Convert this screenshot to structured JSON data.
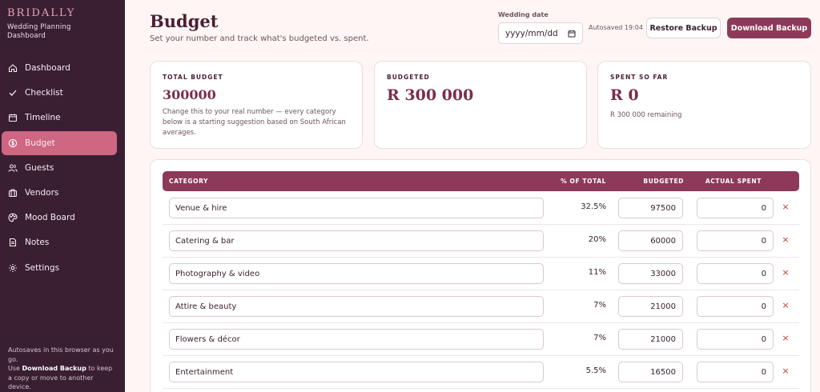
{
  "brand": {
    "name": "BRIDALLY",
    "sub1": "Wedding Planning",
    "sub2": "Dashboard"
  },
  "sidebar": {
    "items": [
      {
        "label": "Dashboard",
        "icon": "home-icon"
      },
      {
        "label": "Checklist",
        "icon": "check-icon"
      },
      {
        "label": "Timeline",
        "icon": "calendar-icon"
      },
      {
        "label": "Budget",
        "icon": "coin-icon",
        "active": true
      },
      {
        "label": "Guests",
        "icon": "users-icon"
      },
      {
        "label": "Vendors",
        "icon": "briefcase-icon"
      },
      {
        "label": "Mood Board",
        "icon": "palette-icon"
      },
      {
        "label": "Notes",
        "icon": "note-icon"
      },
      {
        "label": "Settings",
        "icon": "gear-icon"
      }
    ],
    "footer": {
      "line1": "Autosaves in this browser as you go.",
      "use": "Use ",
      "bold": "Download Backup",
      "line2": " to keep a copy or move to another device."
    }
  },
  "header": {
    "title": "Budget",
    "subtitle": "Set your number and track what's budgeted vs. spent.",
    "date_label": "Wedding date",
    "date_placeholder": "yyyy/mm/dd",
    "autosaved": "Autosaved 19:04",
    "restore_label": "Restore Backup",
    "download_label": "Download Backup"
  },
  "cards": {
    "total": {
      "caption": "TOTAL BUDGET",
      "value": "300000",
      "note": "Change this to your real number — every category below is a starting suggestion based on South African averages."
    },
    "budgeted": {
      "caption": "BUDGETED",
      "value": "R 300 000"
    },
    "spent": {
      "caption": "SPENT SO FAR",
      "value": "R 0",
      "note": "R 300 000 remaining"
    }
  },
  "table": {
    "headers": {
      "category": "CATEGORY",
      "pct": "% OF TOTAL",
      "budgeted": "BUDGETED",
      "actual": "ACTUAL SPENT"
    },
    "rows": [
      {
        "category": "Venue & hire",
        "pct": "32.5%",
        "budgeted": "97500",
        "actual": "0"
      },
      {
        "category": "Catering & bar",
        "pct": "20%",
        "budgeted": "60000",
        "actual": "0"
      },
      {
        "category": "Photography & video",
        "pct": "11%",
        "budgeted": "33000",
        "actual": "0"
      },
      {
        "category": "Attire & beauty",
        "pct": "7%",
        "budgeted": "21000",
        "actual": "0"
      },
      {
        "category": "Flowers & décor",
        "pct": "7%",
        "budgeted": "21000",
        "actual": "0"
      },
      {
        "category": "Entertainment",
        "pct": "5.5%",
        "budgeted": "16500",
        "actual": "0"
      }
    ],
    "delete_glyph": "×"
  },
  "colors": {
    "sidebar": "#3a1f33",
    "accent": "#8d3a5a",
    "active_nav": "#cf6682",
    "delete": "#c0392b"
  }
}
